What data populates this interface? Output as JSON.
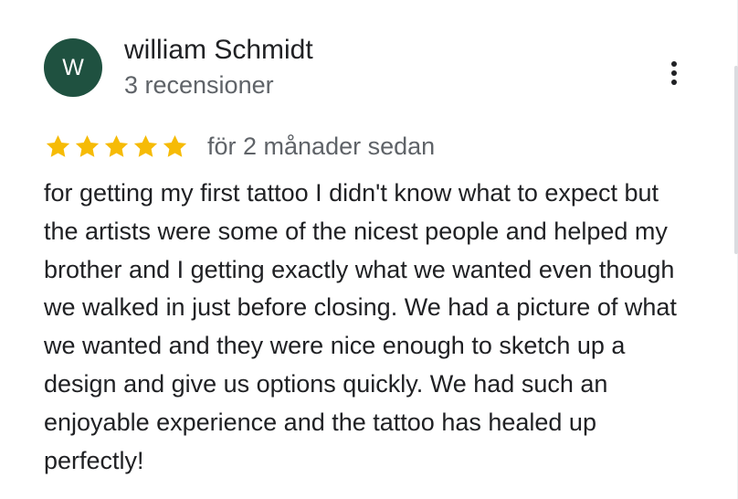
{
  "review": {
    "avatar_letter": "W",
    "avatar_color": "#1f5140",
    "author_name": "william Schmidt",
    "review_count": "3 recensioner",
    "rating": 5,
    "max_rating": 5,
    "star_color": "#f6bb06",
    "time_ago": "för 2 månader sedan",
    "text": "for getting my first tattoo I didn't know what to expect but the artists were some of the nicest people and helped my brother and I getting exactly what we wanted even though we walked in just before closing. We had a picture of what we wanted and they were nice enough to sketch up a design and give us options quickly. We had such an enjoyable experience and the tattoo has healed up perfectly!",
    "more_icon": "more-vertical-icon"
  }
}
